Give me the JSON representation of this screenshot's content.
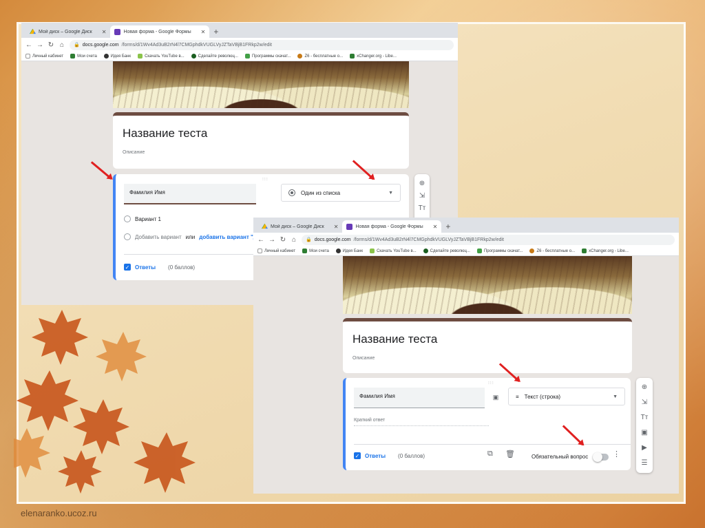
{
  "colors": {
    "form_accent": "#6d4c41",
    "google_blue": "#1a73e8",
    "arrow_red": "#e02020",
    "question_bar": "#4285f4"
  },
  "footer": {
    "site": "elenaranko.ucoz.ru"
  },
  "screenshot_one": {
    "tabs": [
      {
        "icon": "google-drive-icon",
        "label": "Мой диск – Google Диск",
        "close": "✕"
      },
      {
        "icon": "google-forms-icon",
        "label": "Новая форма - Google Формы",
        "close": "✕"
      }
    ],
    "new_tab": "+",
    "address": {
      "domain": "docs.google.com",
      "path": "/forms/d/1Wv4Ad3uB2rN4l7CMGphdkVUGLVyJZTaVBjB1FRkp2w/edit"
    },
    "bookmarks": [
      "Личный кабинет",
      "Мои счета",
      "Идея Банк",
      "Скачать YouTube в...",
      "Сделайте революц...",
      "Программы скачат...",
      "Z6 - бесплатные о...",
      "xChanger.org - Libe..."
    ],
    "form": {
      "title": "Название теста",
      "description": "Описание",
      "question_text": "Фамилия Имя",
      "question_type": "Один из списка",
      "option_1": "Вариант 1",
      "add_option": "Добавить вариант",
      "or_label": "или",
      "add_other": "добавить вариант \"Д",
      "answers_label": "Ответы",
      "points": "(0 баллов)"
    }
  },
  "screenshot_two": {
    "tabs": [
      {
        "icon": "google-drive-icon",
        "label": "Мой диск – Google Диск",
        "close": "✕"
      },
      {
        "icon": "google-forms-icon",
        "label": "Новая форма - Google Формы",
        "close": "✕"
      }
    ],
    "new_tab": "+",
    "address": {
      "domain": "docs.google.com",
      "path": "/forms/d/1Wv4Ad3uB2rN4l7CMGphdkVUGLVyJZTaVBjB1FRkp2w/edit"
    },
    "bookmarks": [
      "Личный кабинет",
      "Мои счета",
      "Идея Банк",
      "Скачать YouTube в...",
      "Сделайте революц...",
      "Программы скачат...",
      "Z6 - бесплатные о...",
      "xChanger.org - Libe..."
    ],
    "form": {
      "title": "Название теста",
      "description": "Описание",
      "question_text": "Фамилия Имя",
      "question_type": "Текст (строка)",
      "short_answer": "Краткий ответ",
      "answers_label": "Ответы",
      "points": "(0 баллов)",
      "required_label": "Обязательный вопрос"
    }
  }
}
